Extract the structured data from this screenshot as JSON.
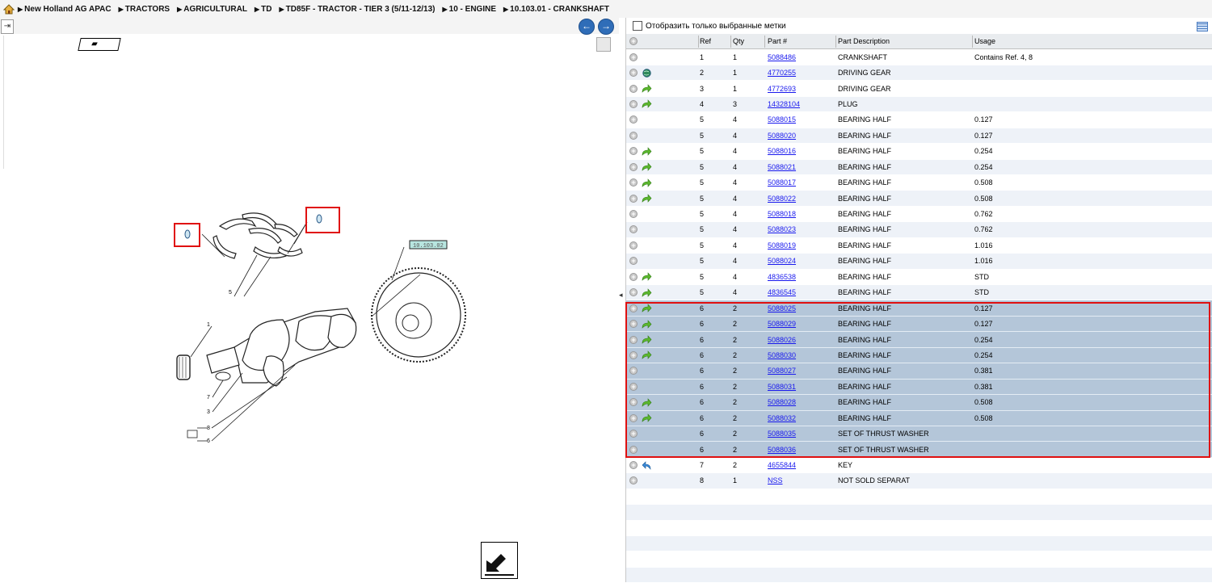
{
  "breadcrumb": [
    "New Holland AG APAC",
    "TRACTORS",
    "AGRICULTURAL",
    "TD",
    "TD85F - TRACTOR - TIER 3 (5/11-12/13)",
    "10 - ENGINE",
    "10.103.01 - CRANKSHAFT"
  ],
  "diagram": {
    "callouts": [
      "5",
      "1",
      "7",
      "3",
      "8",
      "6"
    ],
    "flywheel_tag": "10.103.02"
  },
  "filter": {
    "label": "Отобразить только выбранные метки",
    "checked": false
  },
  "table": {
    "columns": {
      "ref": "Ref",
      "qty": "Qty",
      "part": "Part #",
      "desc": "Part Description",
      "usage": "Usage"
    },
    "rows": [
      {
        "ref": "1",
        "qty": "1",
        "part": "5088486",
        "desc": "CRANKSHAFT",
        "usage": "Contains Ref. 4, 8",
        "icon": "none",
        "selected": false
      },
      {
        "ref": "2",
        "qty": "1",
        "part": "4770255",
        "desc": "DRIVING GEAR",
        "usage": "",
        "icon": "globe-icon",
        "selected": false
      },
      {
        "ref": "3",
        "qty": "1",
        "part": "4772693",
        "desc": "DRIVING GEAR",
        "usage": "",
        "icon": "green-arrow-icon",
        "selected": false
      },
      {
        "ref": "4",
        "qty": "3",
        "part": "14328104",
        "desc": "PLUG",
        "usage": "",
        "icon": "green-arrow-icon",
        "selected": false
      },
      {
        "ref": "5",
        "qty": "4",
        "part": "5088015",
        "desc": "BEARING HALF",
        "usage": "0.127",
        "icon": "none",
        "selected": false
      },
      {
        "ref": "5",
        "qty": "4",
        "part": "5088020",
        "desc": "BEARING HALF",
        "usage": "0.127",
        "icon": "none",
        "selected": false
      },
      {
        "ref": "5",
        "qty": "4",
        "part": "5088016",
        "desc": "BEARING HALF",
        "usage": "0.254",
        "icon": "green-arrow-icon",
        "selected": false
      },
      {
        "ref": "5",
        "qty": "4",
        "part": "5088021",
        "desc": "BEARING HALF",
        "usage": "0.254",
        "icon": "green-arrow-icon",
        "selected": false
      },
      {
        "ref": "5",
        "qty": "4",
        "part": "5088017",
        "desc": "BEARING HALF",
        "usage": "0.508",
        "icon": "green-arrow-icon",
        "selected": false
      },
      {
        "ref": "5",
        "qty": "4",
        "part": "5088022",
        "desc": "BEARING HALF",
        "usage": "0.508",
        "icon": "green-arrow-icon",
        "selected": false
      },
      {
        "ref": "5",
        "qty": "4",
        "part": "5088018",
        "desc": "BEARING HALF",
        "usage": "0.762",
        "icon": "none",
        "selected": false
      },
      {
        "ref": "5",
        "qty": "4",
        "part": "5088023",
        "desc": "BEARING HALF",
        "usage": "0.762",
        "icon": "none",
        "selected": false
      },
      {
        "ref": "5",
        "qty": "4",
        "part": "5088019",
        "desc": "BEARING HALF",
        "usage": "1.016",
        "icon": "none",
        "selected": false
      },
      {
        "ref": "5",
        "qty": "4",
        "part": "5088024",
        "desc": "BEARING HALF",
        "usage": "1.016",
        "icon": "none",
        "selected": false
      },
      {
        "ref": "5",
        "qty": "4",
        "part": "4836538",
        "desc": "BEARING HALF",
        "usage": "STD",
        "icon": "green-arrow-icon",
        "selected": false
      },
      {
        "ref": "5",
        "qty": "4",
        "part": "4836545",
        "desc": "BEARING HALF",
        "usage": "STD",
        "icon": "green-arrow-icon",
        "selected": false
      },
      {
        "ref": "6",
        "qty": "2",
        "part": "5088025",
        "desc": "BEARING HALF",
        "usage": "0.127",
        "icon": "green-arrow-icon",
        "selected": true
      },
      {
        "ref": "6",
        "qty": "2",
        "part": "5088029",
        "desc": "BEARING HALF",
        "usage": "0.127",
        "icon": "green-arrow-icon",
        "selected": true
      },
      {
        "ref": "6",
        "qty": "2",
        "part": "5088026",
        "desc": "BEARING HALF",
        "usage": "0.254",
        "icon": "green-arrow-icon",
        "selected": true
      },
      {
        "ref": "6",
        "qty": "2",
        "part": "5088030",
        "desc": "BEARING HALF",
        "usage": "0.254",
        "icon": "green-arrow-icon",
        "selected": true
      },
      {
        "ref": "6",
        "qty": "2",
        "part": "5088027",
        "desc": "BEARING HALF",
        "usage": "0.381",
        "icon": "none",
        "selected": true
      },
      {
        "ref": "6",
        "qty": "2",
        "part": "5088031",
        "desc": "BEARING HALF",
        "usage": "0.381",
        "icon": "none",
        "selected": true
      },
      {
        "ref": "6",
        "qty": "2",
        "part": "5088028",
        "desc": "BEARING HALF",
        "usage": "0.508",
        "icon": "green-arrow-icon",
        "selected": true
      },
      {
        "ref": "6",
        "qty": "2",
        "part": "5088032",
        "desc": "BEARING HALF",
        "usage": "0.508",
        "icon": "green-arrow-icon",
        "selected": true
      },
      {
        "ref": "6",
        "qty": "2",
        "part": "5088035",
        "desc": "SET OF THRUST WASHER",
        "usage": "",
        "icon": "none",
        "selected": true
      },
      {
        "ref": "6",
        "qty": "2",
        "part": "5088036",
        "desc": "SET OF THRUST WASHER",
        "usage": "",
        "icon": "none",
        "selected": true
      },
      {
        "ref": "7",
        "qty": "2",
        "part": "4655844",
        "desc": "KEY",
        "usage": "",
        "icon": "blue-return-arrow-icon",
        "selected": false
      },
      {
        "ref": "8",
        "qty": "1",
        "part": "NSS",
        "desc": "NOT SOLD SEPARAT",
        "usage": "",
        "icon": "none",
        "selected": false
      }
    ],
    "empty_rows": 6
  },
  "colors": {
    "selected_row": "#b4c6d9",
    "selection_border": "#e01010",
    "link": "#1a1aee",
    "nav_button": "#2f6db8"
  }
}
